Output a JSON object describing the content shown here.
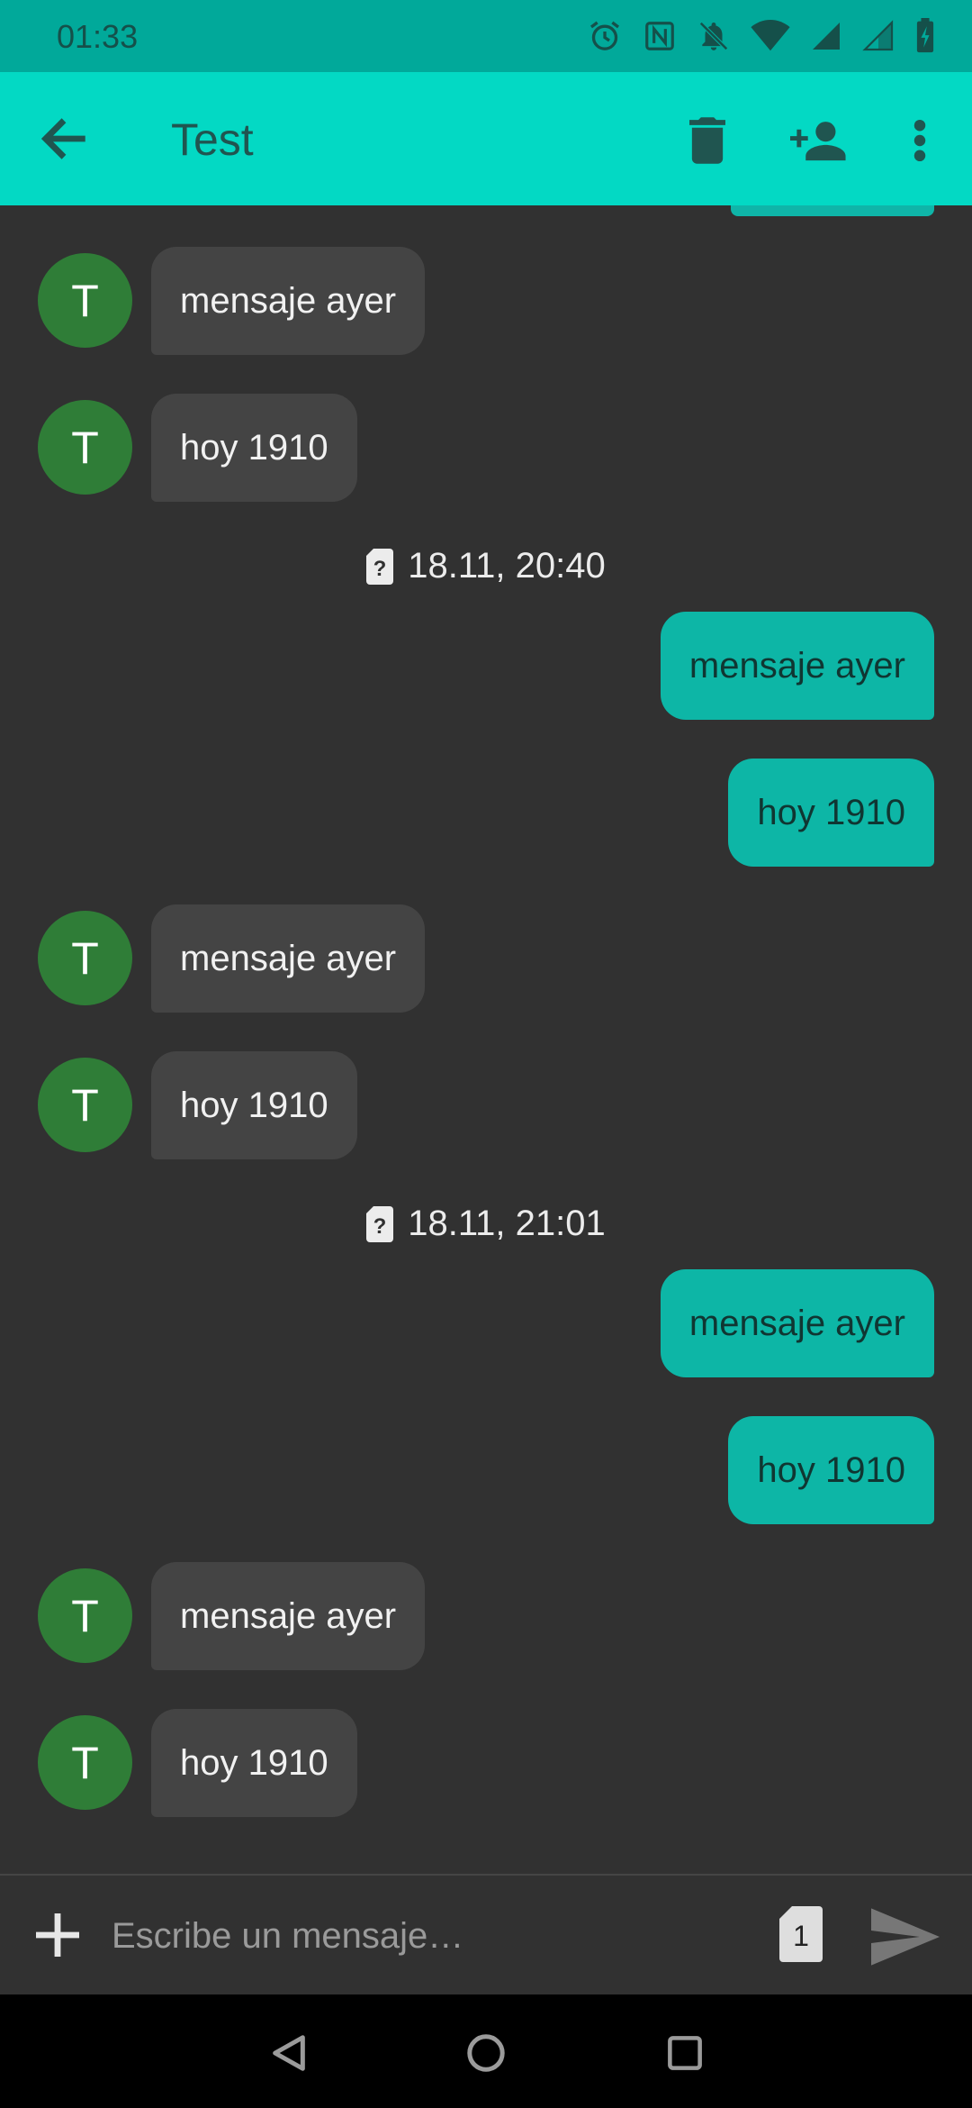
{
  "status_bar": {
    "time": "01:33",
    "icons": [
      "alarm-icon",
      "nfc-icon",
      "notifications-off-icon",
      "wifi-icon",
      "signal-icon",
      "signal-icon",
      "battery-charging-icon"
    ]
  },
  "app_bar": {
    "title": "Test",
    "actions": [
      "delete-icon",
      "add-person-icon",
      "more-vert-icon"
    ]
  },
  "conversation": {
    "groups": [
      {
        "incoming": [
          {
            "avatar": "T",
            "text": "mensaje ayer"
          },
          {
            "avatar": "T",
            "text": "hoy 1910"
          }
        ]
      },
      {
        "timestamp": "18.11, 20:40",
        "outgoing": [
          "mensaje ayer",
          "hoy 1910"
        ],
        "incoming": [
          {
            "avatar": "T",
            "text": "mensaje ayer"
          },
          {
            "avatar": "T",
            "text": "hoy 1910"
          }
        ]
      },
      {
        "timestamp": "18.11, 21:01",
        "outgoing": [
          "mensaje ayer",
          "hoy 1910"
        ],
        "incoming": [
          {
            "avatar": "T",
            "text": "mensaje ayer"
          },
          {
            "avatar": "T",
            "text": "hoy 1910"
          }
        ]
      }
    ]
  },
  "composer": {
    "placeholder": "Escribe un mensaje…",
    "sim_slot": "1"
  },
  "colors": {
    "status_bar": "#01a99a",
    "app_bar": "#03d9c4",
    "background": "#313131",
    "incoming_bubble": "#444444",
    "outgoing_bubble": "#0db6a6",
    "avatar": "#2f7d37"
  }
}
